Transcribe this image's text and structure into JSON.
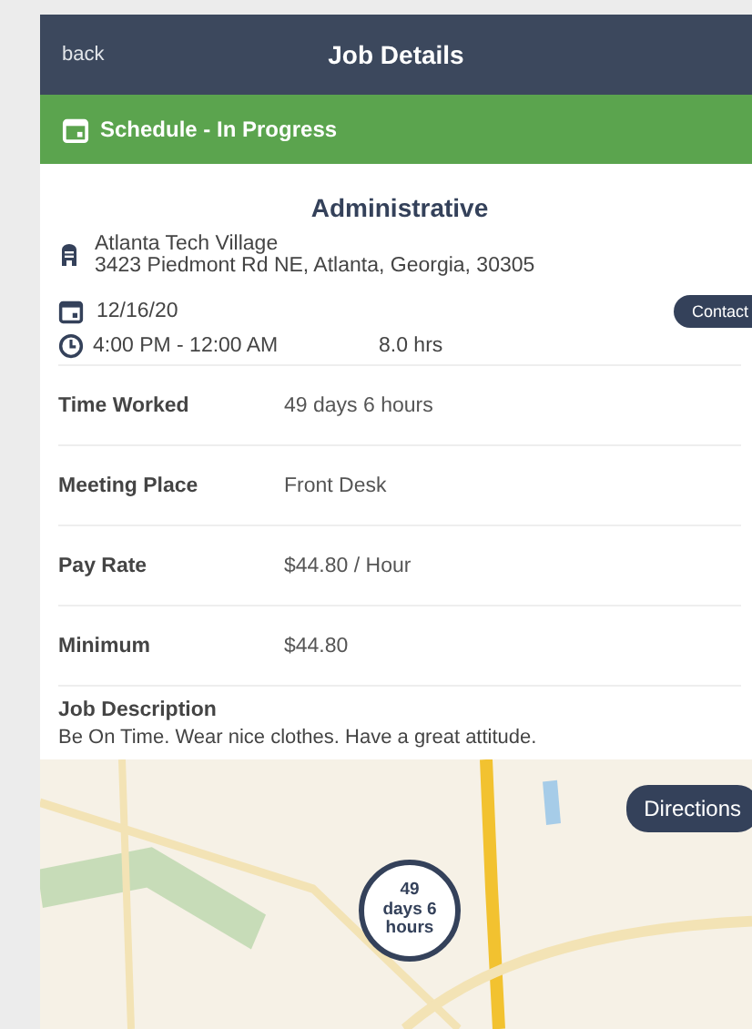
{
  "header": {
    "back": "back",
    "title": "Job Details"
  },
  "status_bar": {
    "label": "Schedule - In Progress"
  },
  "job": {
    "title": "Administrative",
    "location_name": "Atlanta Tech Village",
    "address": "3423 Piedmont Rd NE, Atlanta, Georgia, 30305",
    "date": "12/16/20",
    "contact": "Contact",
    "time": "4:00 PM - 12:00 AM",
    "duration": "8.0 hrs"
  },
  "details": [
    {
      "label": "Time Worked",
      "value": "49 days 6 hours"
    },
    {
      "label": "Meeting Place",
      "value": "Front Desk"
    },
    {
      "label": "Pay Rate",
      "value": "$44.80 / Hour"
    },
    {
      "label": "Minimum",
      "value": "$44.80"
    }
  ],
  "description": {
    "label": "Job Description",
    "text": "Be On Time. Wear nice clothes. Have a great attitude."
  },
  "map": {
    "directions": "Directions",
    "pin_lines": [
      "49",
      "days 6",
      "hours"
    ]
  }
}
